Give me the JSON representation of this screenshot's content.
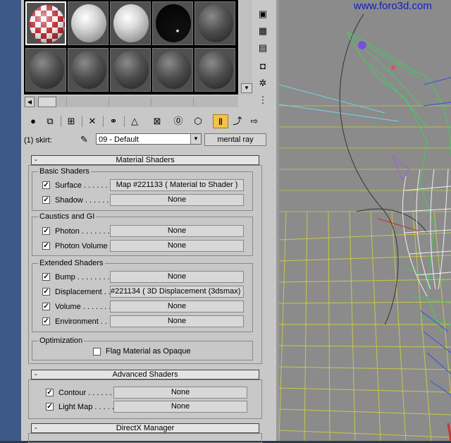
{
  "material_editor": {
    "slots": [
      {
        "type": "checker",
        "selected": true
      },
      {
        "type": "white"
      },
      {
        "type": "white"
      },
      {
        "type": "black"
      },
      {
        "type": "dark"
      },
      {
        "type": "dark"
      },
      {
        "type": "dark"
      },
      {
        "type": "dark"
      },
      {
        "type": "dark"
      },
      {
        "type": "dark"
      }
    ]
  },
  "name_row": {
    "object_label": "(1) skirt:",
    "material_name": "09 - Default",
    "type_button": "mental ray"
  },
  "material_shaders": {
    "title": "Material Shaders",
    "collapse_symbol": "-",
    "basic": {
      "title": "Basic Shaders",
      "rows": [
        {
          "label": "Surface . . . . . .",
          "value": "Map #221133  ( Material to Shader )",
          "checked": true
        },
        {
          "label": "Shadow . . . . . .",
          "value": "None",
          "checked": true
        }
      ]
    },
    "caustics": {
      "title": "Caustics and GI",
      "rows": [
        {
          "label": "Photon . . . . . . .",
          "value": "None",
          "checked": true
        },
        {
          "label": "Photon Volume . .",
          "value": "None",
          "checked": true
        }
      ]
    },
    "extended": {
      "title": "Extended Shaders",
      "rows": [
        {
          "label": "Bump . . . . . . . .",
          "value": "None",
          "checked": true
        },
        {
          "label": "Displacement . . .",
          "value": "#221134  ( 3D Displacement (3dsmax) )",
          "checked": true
        },
        {
          "label": "Volume . . . . . . .",
          "value": "None",
          "checked": true
        },
        {
          "label": "Environment . . .",
          "value": "None",
          "checked": true
        }
      ]
    },
    "optimization": {
      "title": "Optimization",
      "flag_label": "Flag Material as Opaque",
      "flag_checked": false
    }
  },
  "advanced_shaders": {
    "title": "Advanced Shaders",
    "collapse_symbol": "-",
    "rows": [
      {
        "label": "Contour . . . . . .",
        "value": "None",
        "checked": true
      },
      {
        "label": "Light Map . . . . .",
        "value": "None",
        "checked": true
      }
    ]
  },
  "directx": {
    "title": "DirectX Manager",
    "collapse_symbol": "-"
  },
  "viewport": {
    "watermark": "www.foro3d.com"
  },
  "icons": {
    "get_material": "sphere-arrow-icon",
    "put_to_scene": "put-to-scene-icon",
    "assign": "assign-to-selection-icon",
    "delete": "x-icon",
    "make_copy": "make-copy-icon",
    "unique": "make-unique-icon",
    "library": "put-to-library-icon",
    "effects_channel": "effects-channel-icon",
    "show_map": "show-map-icon",
    "show_end": "show-end-result-icon",
    "go_parent": "go-to-parent-icon",
    "go_sibling": "go-forward-sibling-icon"
  }
}
